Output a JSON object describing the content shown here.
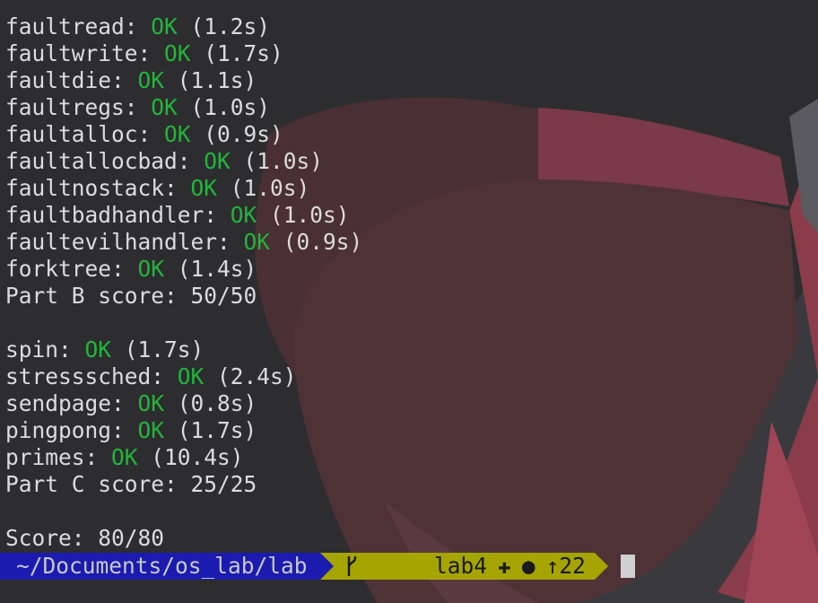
{
  "colors": {
    "ok": "#22b53a",
    "text": "#dcdcdc",
    "prompt_path_bg": "#1c1bb0",
    "prompt_git_bg": "#a6a500",
    "background": "#2c2c2f"
  },
  "terminal": {
    "lines": [
      {
        "name": "faultread",
        "sep": ": ",
        "status": "OK",
        "time": " (1.2s)"
      },
      {
        "name": "faultwrite",
        "sep": ": ",
        "status": "OK",
        "time": " (1.7s)"
      },
      {
        "name": "faultdie",
        "sep": ": ",
        "status": "OK",
        "time": " (1.1s)"
      },
      {
        "name": "faultregs",
        "sep": ": ",
        "status": "OK",
        "time": " (1.0s)"
      },
      {
        "name": "faultalloc",
        "sep": ": ",
        "status": "OK",
        "time": " (0.9s)"
      },
      {
        "name": "faultallocbad",
        "sep": ": ",
        "status": "OK",
        "time": " (1.0s)"
      },
      {
        "name": "faultnostack",
        "sep": ": ",
        "status": "OK",
        "time": " (1.0s)"
      },
      {
        "name": "faultbadhandler",
        "sep": ": ",
        "status": "OK",
        "time": " (1.0s)"
      },
      {
        "name": "faultevilhandler",
        "sep": ": ",
        "status": "OK",
        "time": " (0.9s)"
      },
      {
        "name": "forktree",
        "sep": ": ",
        "status": "OK",
        "time": " (1.4s)"
      },
      {
        "text": "Part B score: 50/50"
      },
      {
        "text": ""
      },
      {
        "name": "spin",
        "sep": ": ",
        "status": "OK",
        "time": " (1.7s)"
      },
      {
        "name": "stresssched",
        "sep": ": ",
        "status": "OK",
        "time": " (2.4s)"
      },
      {
        "name": "sendpage",
        "sep": ": ",
        "status": "OK",
        "time": " (0.8s)"
      },
      {
        "name": "pingpong",
        "sep": ": ",
        "status": "OK",
        "time": " (1.7s)"
      },
      {
        "name": "primes",
        "sep": ": ",
        "status": "OK",
        "time": " (10.4s)"
      },
      {
        "text": "Part C score: 25/25"
      },
      {
        "text": ""
      },
      {
        "text": "Score: 80/80"
      }
    ]
  },
  "prompt": {
    "path": "~/Documents/os_lab/lab",
    "branch_icon": "git-branch-icon",
    "branch": "lab4",
    "staged": "✚",
    "dirty": "●",
    "ahead": "↑22"
  }
}
